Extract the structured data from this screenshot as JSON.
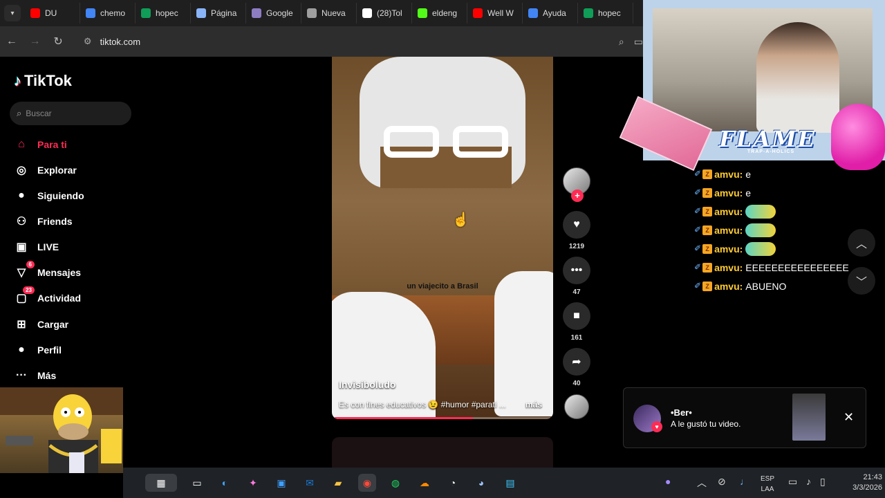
{
  "browser": {
    "tabs": [
      {
        "label": "DU",
        "color": "#ff0000"
      },
      {
        "label": "chemo",
        "color": "#4285f4"
      },
      {
        "label": "hopec",
        "color": "#0f9d58"
      },
      {
        "label": "Página",
        "color": "#8ab4f8"
      },
      {
        "label": "Google",
        "color": "#8e7cc3"
      },
      {
        "label": "Nueva",
        "color": "#9e9e9e"
      },
      {
        "label": "(28)Tol",
        "color": "#ffffff"
      },
      {
        "label": "eldeng",
        "color": "#53fc18"
      },
      {
        "label": "Well W",
        "color": "#ff0000"
      },
      {
        "label": "Ayuda",
        "color": "#4285f4"
      },
      {
        "label": "hopec",
        "color": "#0f9d58"
      }
    ],
    "url": "tiktok.com"
  },
  "tiktok": {
    "logo": "TikTok",
    "search_placeholder": "Buscar",
    "nav": [
      {
        "label": "Para ti",
        "icon": "home-icon",
        "glyph": "⌂",
        "badge": ""
      },
      {
        "label": "Explorar",
        "icon": "compass-icon",
        "glyph": "◎",
        "badge": ""
      },
      {
        "label": "Siguiendo",
        "icon": "following-avatar-icon",
        "glyph": "●",
        "badge": ""
      },
      {
        "label": "Friends",
        "icon": "friends-icon",
        "glyph": "⚇",
        "badge": ""
      },
      {
        "label": "LIVE",
        "icon": "live-icon",
        "glyph": "▣",
        "badge": ""
      },
      {
        "label": "Mensajes",
        "icon": "messages-icon",
        "glyph": "▽",
        "badge": "6"
      },
      {
        "label": "Actividad",
        "icon": "activity-icon",
        "glyph": "▢",
        "badge": "23"
      },
      {
        "label": "Cargar",
        "icon": "upload-icon",
        "glyph": "⊞",
        "badge": ""
      },
      {
        "label": "Perfil",
        "icon": "profile-avatar-icon",
        "glyph": "●",
        "badge": ""
      },
      {
        "label": "Más",
        "icon": "more-icon",
        "glyph": "···",
        "badge": ""
      }
    ]
  },
  "video": {
    "overlay_caption": "un viajecito a Brasil",
    "author": "Invisiboludo",
    "description": "Es con fines educativos 😉 #humor #parati ...",
    "more": "más",
    "progress": 0.64,
    "likes": "1219",
    "comments": "47",
    "saves": "161",
    "shares": "40"
  },
  "stream": {
    "overlay_title": "FLAME",
    "overlay_subtitle": "TRAP-A-HOLICS",
    "chat": [
      {
        "user": "amvu:",
        "msg": "e",
        "emote": false
      },
      {
        "user": "amvu:",
        "msg": "e",
        "emote": false
      },
      {
        "user": "amvu:",
        "msg": "",
        "emote": true
      },
      {
        "user": "amvu:",
        "msg": "",
        "emote": true
      },
      {
        "user": "amvu:",
        "msg": "",
        "emote": true
      },
      {
        "user": "amvu:",
        "msg": "EEEEEEEEEEEEEEEE",
        "emote": false
      },
      {
        "user": "amvu:",
        "msg": "ABUENO",
        "emote": false
      }
    ]
  },
  "notification": {
    "name": "•Ber•",
    "text": "A le gustó tu video."
  },
  "taskbar": {
    "language": "ESP",
    "layout": "LAA",
    "time": "21:43",
    "date": "3/3/2026"
  },
  "colors": {
    "accent": "#fe2c55",
    "chat_user": "#ffcc33"
  }
}
